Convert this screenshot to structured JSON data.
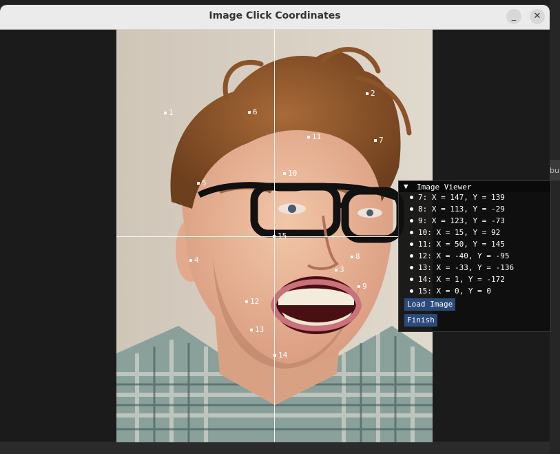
{
  "window": {
    "title": "Image Click Coordinates",
    "minimize_symbol": "_",
    "close_symbol": "✕"
  },
  "desktop": {
    "partial_text": "bui"
  },
  "image": {
    "description_icon": "photo-of-man-with-glasses",
    "markers": [
      {
        "id": "1",
        "label": "1"
      },
      {
        "id": "2",
        "label": "2"
      },
      {
        "id": "3",
        "label": "3"
      },
      {
        "id": "4",
        "label": "4"
      },
      {
        "id": "5",
        "label": "5"
      },
      {
        "id": "6",
        "label": "6"
      },
      {
        "id": "7",
        "label": "7"
      },
      {
        "id": "8",
        "label": "8"
      },
      {
        "id": "9",
        "label": "9"
      },
      {
        "id": "10",
        "label": "10"
      },
      {
        "id": "11",
        "label": "11"
      },
      {
        "id": "12",
        "label": "12"
      },
      {
        "id": "13",
        "label": "13"
      },
      {
        "id": "14",
        "label": "14"
      },
      {
        "id": "15",
        "label": "15"
      }
    ]
  },
  "panel": {
    "title": "Image Viewer",
    "collapse_symbol": "▼",
    "entries": [
      "7: X = 147, Y = 139",
      "8: X = 113, Y = -29",
      "9: X = 123, Y = -73",
      "10: X = 15, Y = 92",
      "11: X = 50, Y = 145",
      "12: X = -40, Y = -95",
      "13: X = -33, Y = -136",
      "14: X = 1, Y = -172",
      "15: X = 0, Y = 0"
    ],
    "load_button": "Load Image",
    "finish_button": "Finish"
  }
}
